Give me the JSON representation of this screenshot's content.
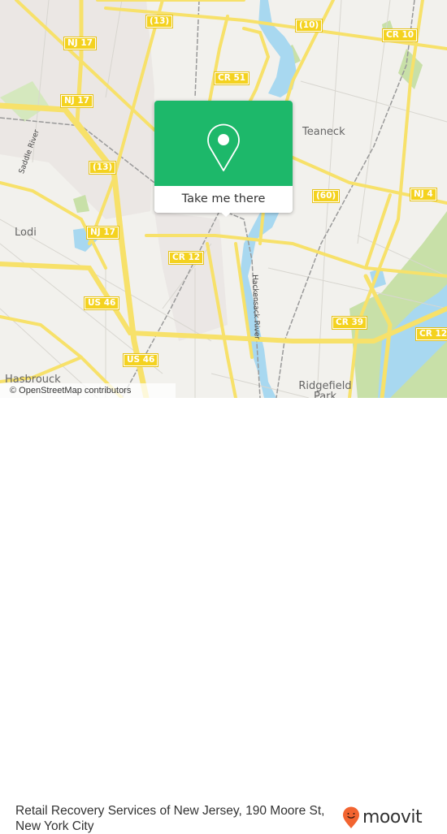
{
  "map": {
    "place_labels": [
      {
        "name": "Teaneck"
      },
      {
        "name": "Lodi"
      },
      {
        "name": "Hasbrouck"
      },
      {
        "name": "Ridgefield Park"
      }
    ],
    "river_labels": [
      {
        "name": "Saddle River"
      },
      {
        "name": "Hackensack River"
      }
    ],
    "route_shields": [
      {
        "label": "(13)"
      },
      {
        "label": "NJ 17"
      },
      {
        "label": "NJ 17"
      },
      {
        "label": "(13)"
      },
      {
        "label": "(10)"
      },
      {
        "label": "CR 10"
      },
      {
        "label": "CR 51"
      },
      {
        "label": "(60)"
      },
      {
        "label": "NJ 4"
      },
      {
        "label": "NJ 17"
      },
      {
        "label": "CR 12"
      },
      {
        "label": "US 46"
      },
      {
        "label": "US 46"
      },
      {
        "label": "CR 39"
      },
      {
        "label": "CR 12"
      }
    ],
    "attribution": "© OpenStreetMap contributors",
    "colors": {
      "land": "#f2f1ed",
      "road": "#f7e16a",
      "water": "#a8d8f0",
      "park": "#c8e0a8"
    }
  },
  "popup": {
    "icon": "map-pin-icon",
    "cta_label": "Take me there",
    "color": "#1db86a"
  },
  "footer": {
    "title": "Retail Recovery Services of New Jersey, 190 Moore St, New York City",
    "logo_text": "moovit",
    "logo_icon": "moovit-pin-icon",
    "logo_color": "#f26430"
  }
}
